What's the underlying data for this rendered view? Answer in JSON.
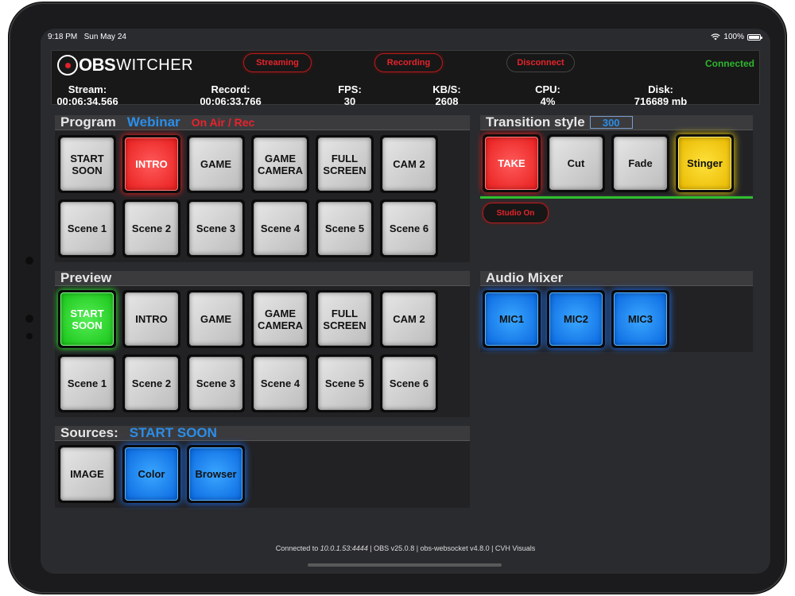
{
  "status_bar": {
    "time": "9:18 PM",
    "date": "Sun May 24",
    "battery": "100%"
  },
  "app": {
    "logo_obs": "OBS",
    "logo_witcher": "WITCHER"
  },
  "header": {
    "streaming": "Streaming",
    "recording": "Recording",
    "disconnect": "Disconnect",
    "connection_status": "Connected"
  },
  "stats": [
    {
      "label": "Stream:",
      "value": "00:06:34.566"
    },
    {
      "label": "Record:",
      "value": "00:06:33.766"
    },
    {
      "label": "FPS:",
      "value": "30"
    },
    {
      "label": "KB/S:",
      "value": "2608"
    },
    {
      "label": "CPU:",
      "value": "4%"
    },
    {
      "label": "Disk:",
      "value": "716689 mb"
    }
  ],
  "program": {
    "title": "Program",
    "profile": "Webinar",
    "state": "On Air / Rec",
    "scenes": [
      "START SOON",
      "INTRO",
      "GAME",
      "GAME CAMERA",
      "FULL SCREEN",
      "CAM 2",
      "Scene 1",
      "Scene 2",
      "Scene 3",
      "Scene 4",
      "Scene 5",
      "Scene 6"
    ],
    "active": "INTRO"
  },
  "preview": {
    "title": "Preview",
    "scenes": [
      "START SOON",
      "INTRO",
      "GAME",
      "GAME CAMERA",
      "FULL SCREEN",
      "CAM 2",
      "Scene 1",
      "Scene 2",
      "Scene 3",
      "Scene 4",
      "Scene 5",
      "Scene 6"
    ],
    "active": "START SOON"
  },
  "sources": {
    "title": "Sources:",
    "scene": "START SOON",
    "items": [
      "IMAGE",
      "Color",
      "Browser"
    ]
  },
  "transition": {
    "title": "Transition style",
    "duration": "300",
    "buttons": [
      "TAKE",
      "Cut",
      "Fade",
      "Stinger"
    ],
    "studio": "Studio On"
  },
  "audio": {
    "title": "Audio Mixer",
    "channels": [
      "MIC1",
      "MIC2",
      "MIC3"
    ]
  },
  "footer": {
    "prefix": "Connected to ",
    "address": "10.0.1.53:4444",
    "rest": " | OBS v25.0.8 | obs-websocket v4.8.0 | CVH Visuals"
  },
  "colors": {
    "accent_blue": "#2b8ee8",
    "live_red": "#e8232b",
    "preview_green": "#18c418",
    "connected_green": "#2fb52f",
    "stinger_yellow": "#e8b800"
  }
}
